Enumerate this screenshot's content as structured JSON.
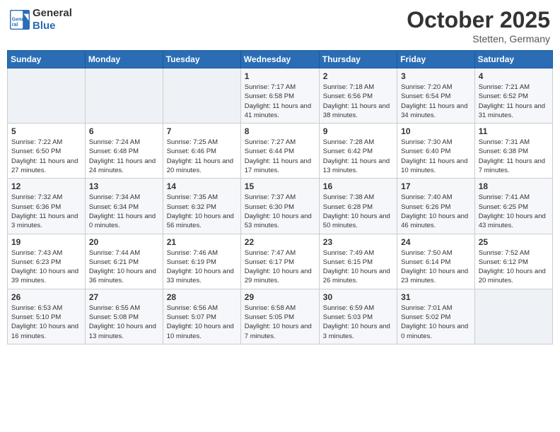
{
  "header": {
    "logo_line1": "General",
    "logo_line2": "Blue",
    "month": "October 2025",
    "location": "Stetten, Germany"
  },
  "weekdays": [
    "Sunday",
    "Monday",
    "Tuesday",
    "Wednesday",
    "Thursday",
    "Friday",
    "Saturday"
  ],
  "weeks": [
    [
      {
        "day": "",
        "sunrise": "",
        "sunset": "",
        "daylight": ""
      },
      {
        "day": "",
        "sunrise": "",
        "sunset": "",
        "daylight": ""
      },
      {
        "day": "",
        "sunrise": "",
        "sunset": "",
        "daylight": ""
      },
      {
        "day": "1",
        "sunrise": "Sunrise: 7:17 AM",
        "sunset": "Sunset: 6:58 PM",
        "daylight": "Daylight: 11 hours and 41 minutes."
      },
      {
        "day": "2",
        "sunrise": "Sunrise: 7:18 AM",
        "sunset": "Sunset: 6:56 PM",
        "daylight": "Daylight: 11 hours and 38 minutes."
      },
      {
        "day": "3",
        "sunrise": "Sunrise: 7:20 AM",
        "sunset": "Sunset: 6:54 PM",
        "daylight": "Daylight: 11 hours and 34 minutes."
      },
      {
        "day": "4",
        "sunrise": "Sunrise: 7:21 AM",
        "sunset": "Sunset: 6:52 PM",
        "daylight": "Daylight: 11 hours and 31 minutes."
      }
    ],
    [
      {
        "day": "5",
        "sunrise": "Sunrise: 7:22 AM",
        "sunset": "Sunset: 6:50 PM",
        "daylight": "Daylight: 11 hours and 27 minutes."
      },
      {
        "day": "6",
        "sunrise": "Sunrise: 7:24 AM",
        "sunset": "Sunset: 6:48 PM",
        "daylight": "Daylight: 11 hours and 24 minutes."
      },
      {
        "day": "7",
        "sunrise": "Sunrise: 7:25 AM",
        "sunset": "Sunset: 6:46 PM",
        "daylight": "Daylight: 11 hours and 20 minutes."
      },
      {
        "day": "8",
        "sunrise": "Sunrise: 7:27 AM",
        "sunset": "Sunset: 6:44 PM",
        "daylight": "Daylight: 11 hours and 17 minutes."
      },
      {
        "day": "9",
        "sunrise": "Sunrise: 7:28 AM",
        "sunset": "Sunset: 6:42 PM",
        "daylight": "Daylight: 11 hours and 13 minutes."
      },
      {
        "day": "10",
        "sunrise": "Sunrise: 7:30 AM",
        "sunset": "Sunset: 6:40 PM",
        "daylight": "Daylight: 11 hours and 10 minutes."
      },
      {
        "day": "11",
        "sunrise": "Sunrise: 7:31 AM",
        "sunset": "Sunset: 6:38 PM",
        "daylight": "Daylight: 11 hours and 7 minutes."
      }
    ],
    [
      {
        "day": "12",
        "sunrise": "Sunrise: 7:32 AM",
        "sunset": "Sunset: 6:36 PM",
        "daylight": "Daylight: 11 hours and 3 minutes."
      },
      {
        "day": "13",
        "sunrise": "Sunrise: 7:34 AM",
        "sunset": "Sunset: 6:34 PM",
        "daylight": "Daylight: 11 hours and 0 minutes."
      },
      {
        "day": "14",
        "sunrise": "Sunrise: 7:35 AM",
        "sunset": "Sunset: 6:32 PM",
        "daylight": "Daylight: 10 hours and 56 minutes."
      },
      {
        "day": "15",
        "sunrise": "Sunrise: 7:37 AM",
        "sunset": "Sunset: 6:30 PM",
        "daylight": "Daylight: 10 hours and 53 minutes."
      },
      {
        "day": "16",
        "sunrise": "Sunrise: 7:38 AM",
        "sunset": "Sunset: 6:28 PM",
        "daylight": "Daylight: 10 hours and 50 minutes."
      },
      {
        "day": "17",
        "sunrise": "Sunrise: 7:40 AM",
        "sunset": "Sunset: 6:26 PM",
        "daylight": "Daylight: 10 hours and 46 minutes."
      },
      {
        "day": "18",
        "sunrise": "Sunrise: 7:41 AM",
        "sunset": "Sunset: 6:25 PM",
        "daylight": "Daylight: 10 hours and 43 minutes."
      }
    ],
    [
      {
        "day": "19",
        "sunrise": "Sunrise: 7:43 AM",
        "sunset": "Sunset: 6:23 PM",
        "daylight": "Daylight: 10 hours and 39 minutes."
      },
      {
        "day": "20",
        "sunrise": "Sunrise: 7:44 AM",
        "sunset": "Sunset: 6:21 PM",
        "daylight": "Daylight: 10 hours and 36 minutes."
      },
      {
        "day": "21",
        "sunrise": "Sunrise: 7:46 AM",
        "sunset": "Sunset: 6:19 PM",
        "daylight": "Daylight: 10 hours and 33 minutes."
      },
      {
        "day": "22",
        "sunrise": "Sunrise: 7:47 AM",
        "sunset": "Sunset: 6:17 PM",
        "daylight": "Daylight: 10 hours and 29 minutes."
      },
      {
        "day": "23",
        "sunrise": "Sunrise: 7:49 AM",
        "sunset": "Sunset: 6:15 PM",
        "daylight": "Daylight: 10 hours and 26 minutes."
      },
      {
        "day": "24",
        "sunrise": "Sunrise: 7:50 AM",
        "sunset": "Sunset: 6:14 PM",
        "daylight": "Daylight: 10 hours and 23 minutes."
      },
      {
        "day": "25",
        "sunrise": "Sunrise: 7:52 AM",
        "sunset": "Sunset: 6:12 PM",
        "daylight": "Daylight: 10 hours and 20 minutes."
      }
    ],
    [
      {
        "day": "26",
        "sunrise": "Sunrise: 6:53 AM",
        "sunset": "Sunset: 5:10 PM",
        "daylight": "Daylight: 10 hours and 16 minutes."
      },
      {
        "day": "27",
        "sunrise": "Sunrise: 6:55 AM",
        "sunset": "Sunset: 5:08 PM",
        "daylight": "Daylight: 10 hours and 13 minutes."
      },
      {
        "day": "28",
        "sunrise": "Sunrise: 6:56 AM",
        "sunset": "Sunset: 5:07 PM",
        "daylight": "Daylight: 10 hours and 10 minutes."
      },
      {
        "day": "29",
        "sunrise": "Sunrise: 6:58 AM",
        "sunset": "Sunset: 5:05 PM",
        "daylight": "Daylight: 10 hours and 7 minutes."
      },
      {
        "day": "30",
        "sunrise": "Sunrise: 6:59 AM",
        "sunset": "Sunset: 5:03 PM",
        "daylight": "Daylight: 10 hours and 3 minutes."
      },
      {
        "day": "31",
        "sunrise": "Sunrise: 7:01 AM",
        "sunset": "Sunset: 5:02 PM",
        "daylight": "Daylight: 10 hours and 0 minutes."
      },
      {
        "day": "",
        "sunrise": "",
        "sunset": "",
        "daylight": ""
      }
    ]
  ]
}
